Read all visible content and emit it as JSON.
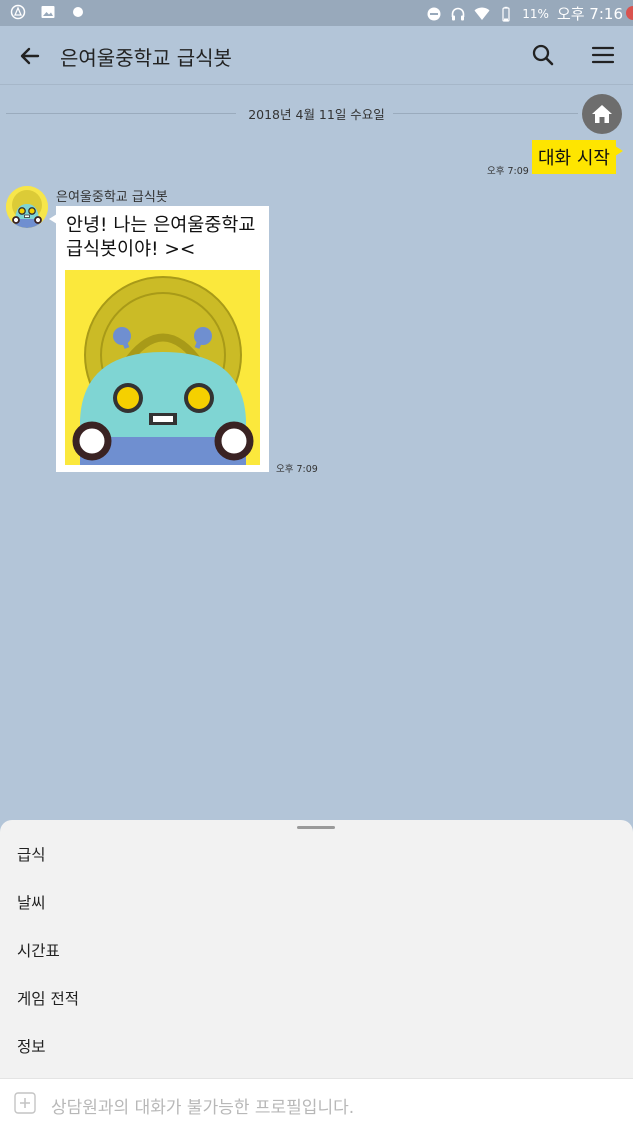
{
  "status_bar": {
    "battery_percent": "11%",
    "time": "오후 7:16",
    "icons_left": [
      "app-icon",
      "image-icon",
      "dot-icon"
    ],
    "icons_right": [
      "dnd-icon",
      "headphones-icon",
      "wifi-icon",
      "battery-icon"
    ]
  },
  "app_bar": {
    "title": "은여울중학교 급식봇",
    "back_icon": "arrow-left-icon",
    "search_icon": "search-icon",
    "menu_icon": "hamburger-icon"
  },
  "chat": {
    "date_divider": "2018년 4월 11일 수요일",
    "messages": [
      {
        "direction": "out",
        "text": "대화 시작",
        "time": "오후 7:09"
      },
      {
        "direction": "in",
        "sender": "은여울중학교 급식봇",
        "text": "안녕! 나는 은여울중학교 급식봇이야! ><",
        "time": "오후 7:09",
        "image": "bot-mascot"
      }
    ]
  },
  "quick_menu": {
    "items": [
      "급식",
      "날씨",
      "시간표",
      "게임 전적",
      "정보"
    ]
  },
  "input_bar": {
    "placeholder": "상담원과의 대화가 불가능한 프로필입니다."
  },
  "colors": {
    "chat_background": "#b3c5d8",
    "outgoing_bubble": "#fee500",
    "incoming_bubble": "#ffffff",
    "status_bar": "#98a9bb"
  }
}
